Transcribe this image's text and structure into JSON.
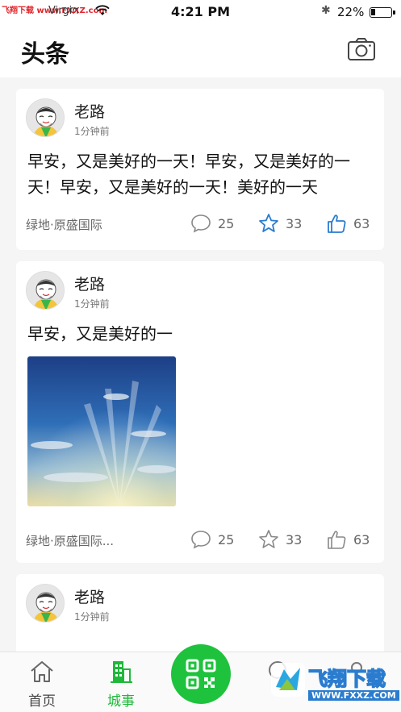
{
  "status_bar": {
    "carrier": "Virgin",
    "time": "4:21 PM",
    "battery_pct": "22%",
    "battery_level": 0.22
  },
  "watermarks": {
    "top_left": "飞翔下载 www.FXXZ.com",
    "bottom_right_name": "飞翔下载",
    "bottom_right_url": "WWW.FXXZ.COM"
  },
  "header": {
    "title": "头条",
    "camera_icon": "camera-icon"
  },
  "posts": [
    {
      "author": "老路",
      "time": "1分钟前",
      "content": "早安，又是美好的一天！早安，又是美好的一天！早安，又是美好的一天！美好的一天",
      "location": "绿地·原盛国际",
      "comments": "25",
      "stars": "33",
      "likes": "63",
      "star_color": "#2a7ccf",
      "like_color": "#2a7ccf"
    },
    {
      "author": "老路",
      "time": "1分钟前",
      "content": "早安，又是美好的一",
      "image": "sky-photo",
      "location": "绿地·原盛国际...",
      "comments": "25",
      "stars": "33",
      "likes": "63"
    },
    {
      "author": "老路",
      "time": "1分钟前"
    }
  ],
  "tabbar": {
    "home": "首页",
    "city": "城事",
    "messages": "",
    "me": "",
    "active_color": "#1fb83a",
    "scan_color": "#1ec23d"
  }
}
